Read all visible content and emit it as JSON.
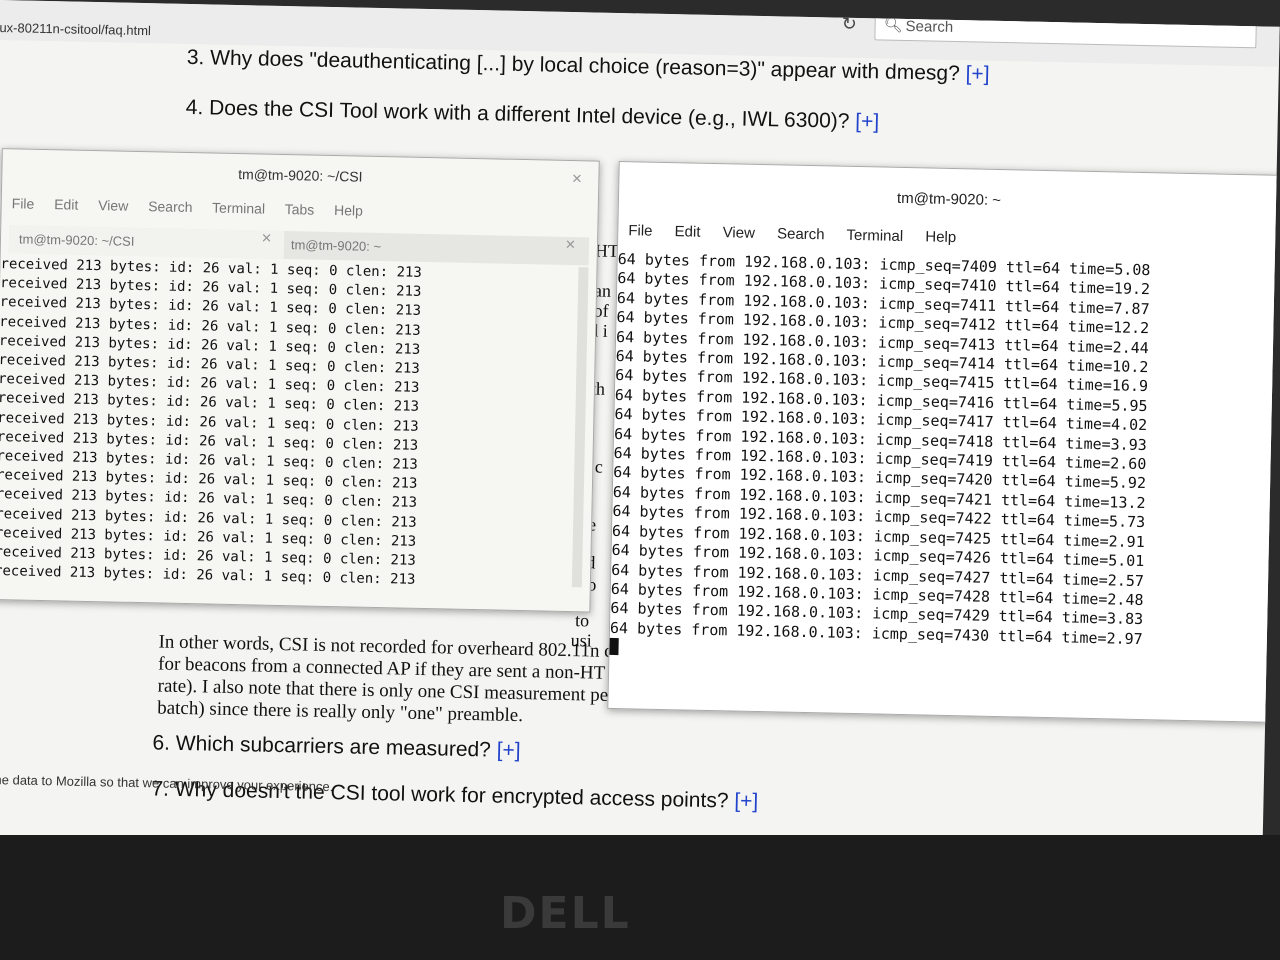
{
  "browser": {
    "url": "ux-80211n-csitool/faq.html",
    "search_placeholder": "Search"
  },
  "faq": {
    "q3": "3. Why does \"deauthenticating [...] by local choice (reason=3)\" appear with dmesg?",
    "q4": "4. Does the CSI Tool work with a different Intel device (e.g., IWL 6300)?",
    "q6": "6. Which subcarriers are measured?",
    "q7": "7. Why doesn't the CSI tool work for encrypted access points?",
    "plus": "[+]",
    "paragraph_lines": [
      "In other words, CSI is not recorded for overheard 802.11n conversations. It is also not recorded",
      "for beacons from a connected AP if they are sent a non-HT rate (e.g., the 802.11a/g 6 Mbps",
      "rate). I also note that there is only one CSI measurement per 802.11n A-MPDU (aggregation",
      "batch) since there is really only \"one\" preamble."
    ],
    "behind_fragments": [
      "HT",
      "an",
      "of",
      "d i",
      "ith",
      "e c",
      "ne",
      "ed",
      "s o",
      "to",
      "usi"
    ],
    "firefox_notice": "ome data to Mozilla so that we can improve your experience."
  },
  "terminal_left": {
    "title": "tm@tm-9020: ~/CSI",
    "menu": [
      "File",
      "Edit",
      "View",
      "Search",
      "Terminal",
      "Tabs",
      "Help"
    ],
    "tabs": [
      "tm@tm-9020: ~/CSI",
      "tm@tm-9020: ~"
    ],
    "lines": [
      "received 213 bytes: id: 26 val: 1 seq: 0 clen: 213",
      "received 213 bytes: id: 26 val: 1 seq: 0 clen: 213",
      "received 213 bytes: id: 26 val: 1 seq: 0 clen: 213",
      "received 213 bytes: id: 26 val: 1 seq: 0 clen: 213",
      "received 213 bytes: id: 26 val: 1 seq: 0 clen: 213",
      "received 213 bytes: id: 26 val: 1 seq: 0 clen: 213",
      "received 213 bytes: id: 26 val: 1 seq: 0 clen: 213",
      "received 213 bytes: id: 26 val: 1 seq: 0 clen: 213",
      "received 213 bytes: id: 26 val: 1 seq: 0 clen: 213",
      "received 213 bytes: id: 26 val: 1 seq: 0 clen: 213",
      "received 213 bytes: id: 26 val: 1 seq: 0 clen: 213",
      "received 213 bytes: id: 26 val: 1 seq: 0 clen: 213",
      "received 213 bytes: id: 26 val: 1 seq: 0 clen: 213",
      "received 213 bytes: id: 26 val: 1 seq: 0 clen: 213",
      "received 213 bytes: id: 26 val: 1 seq: 0 clen: 213",
      "received 213 bytes: id: 26 val: 1 seq: 0 clen: 213",
      "received 213 bytes: id: 26 val: 1 seq: 0 clen: 213"
    ]
  },
  "terminal_right": {
    "title": "tm@tm-9020: ~",
    "menu": [
      "File",
      "Edit",
      "View",
      "Search",
      "Terminal",
      "Help"
    ],
    "lines": [
      "64 bytes from 192.168.0.103: icmp_seq=7409 ttl=64 time=5.08",
      "64 bytes from 192.168.0.103: icmp_seq=7410 ttl=64 time=19.2",
      "64 bytes from 192.168.0.103: icmp_seq=7411 ttl=64 time=7.87",
      "64 bytes from 192.168.0.103: icmp_seq=7412 ttl=64 time=12.2",
      "64 bytes from 192.168.0.103: icmp_seq=7413 ttl=64 time=2.44",
      "64 bytes from 192.168.0.103: icmp_seq=7414 ttl=64 time=10.2",
      "64 bytes from 192.168.0.103: icmp_seq=7415 ttl=64 time=16.9",
      "64 bytes from 192.168.0.103: icmp_seq=7416 ttl=64 time=5.95",
      "64 bytes from 192.168.0.103: icmp_seq=7417 ttl=64 time=4.02",
      "64 bytes from 192.168.0.103: icmp_seq=7418 ttl=64 time=3.93",
      "64 bytes from 192.168.0.103: icmp_seq=7419 ttl=64 time=2.60",
      "64 bytes from 192.168.0.103: icmp_seq=7420 ttl=64 time=5.92",
      "64 bytes from 192.168.0.103: icmp_seq=7421 ttl=64 time=13.2",
      "64 bytes from 192.168.0.103: icmp_seq=7422 ttl=64 time=5.73",
      "64 bytes from 192.168.0.103: icmp_seq=7425 ttl=64 time=2.91",
      "64 bytes from 192.168.0.103: icmp_seq=7426 ttl=64 time=5.01",
      "64 bytes from 192.168.0.103: icmp_seq=7427 ttl=64 time=2.57",
      "64 bytes from 192.168.0.103: icmp_seq=7428 ttl=64 time=2.48",
      "64 bytes from 192.168.0.103: icmp_seq=7429 ttl=64 time=3.83",
      "64 bytes from 192.168.0.103: icmp_seq=7430 ttl=64 time=2.97"
    ]
  },
  "monitor": {
    "brand": "DELL"
  }
}
